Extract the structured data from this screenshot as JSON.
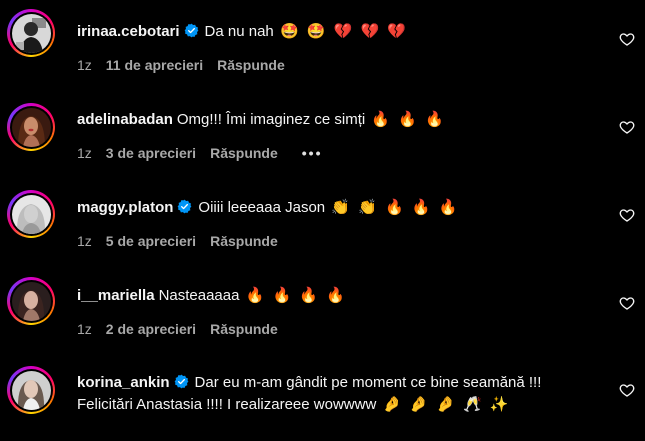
{
  "comments": [
    {
      "username": "irinaa.cebotari",
      "verified": true,
      "text": "Da nu nah",
      "emojis": "🤩 🤩 💔 💔 💔",
      "time": "1z",
      "likes": "11 de aprecieri",
      "reply": "Răspunde",
      "show_more": false
    },
    {
      "username": "adelinabadan",
      "verified": false,
      "text": "Omg!!! Îmi imaginez ce simți",
      "emojis": "🔥 🔥 🔥",
      "time": "1z",
      "likes": "3 de aprecieri",
      "reply": "Răspunde",
      "more": "•••",
      "show_more": true
    },
    {
      "username": "maggy.platon",
      "verified": true,
      "text": "Oiiii leeeaaa Jason",
      "emojis": "👏 👏 🔥 🔥 🔥",
      "time": "1z",
      "likes": "5 de aprecieri",
      "reply": "Răspunde",
      "show_more": false
    },
    {
      "username": "i__mariella",
      "verified": false,
      "text": "Nasteaaaaa",
      "emojis": "🔥 🔥 🔥 🔥",
      "time": "1z",
      "likes": "2 de aprecieri",
      "reply": "Răspunde",
      "show_more": false
    },
    {
      "username": "korina_ankin",
      "verified": true,
      "text": "Dar eu m-am gândit pe moment ce bine seamănă !!! Felicitări Anastasia !!!! I realizareee wowwww",
      "emojis": "🤌 🤌 🤌 🥂 ✨",
      "show_more": false
    }
  ],
  "colors": {
    "background": "#000000",
    "text": "#f5f5f5",
    "muted": "#a8a8a8",
    "verified": "#0095f6"
  },
  "icons": {
    "verified": "verified-badge-icon",
    "like": "heart-outline-icon"
  }
}
